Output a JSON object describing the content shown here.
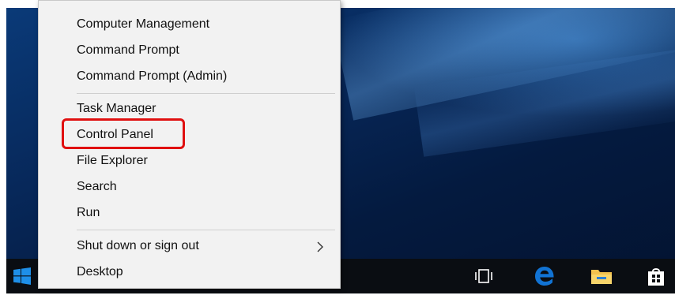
{
  "menu": {
    "items": [
      "Computer Management",
      "Command Prompt",
      "Command Prompt (Admin)",
      "Task Manager",
      "Control Panel",
      "File Explorer",
      "Search",
      "Run",
      "Shut down or sign out",
      "Desktop"
    ],
    "highlighted_item": "Control Panel"
  },
  "taskbar": {
    "icons": [
      "windows-logo-icon",
      "task-view-icon",
      "edge-icon",
      "file-explorer-icon",
      "store-icon"
    ]
  },
  "colors": {
    "menu_bg": "#f2f2f2",
    "highlight": "#e01010",
    "taskbar_bg": "#0a0d12",
    "windows_blue": "#1e8fe8",
    "edge_blue": "#1173d4",
    "folder_yellow": "#f2c14e"
  }
}
